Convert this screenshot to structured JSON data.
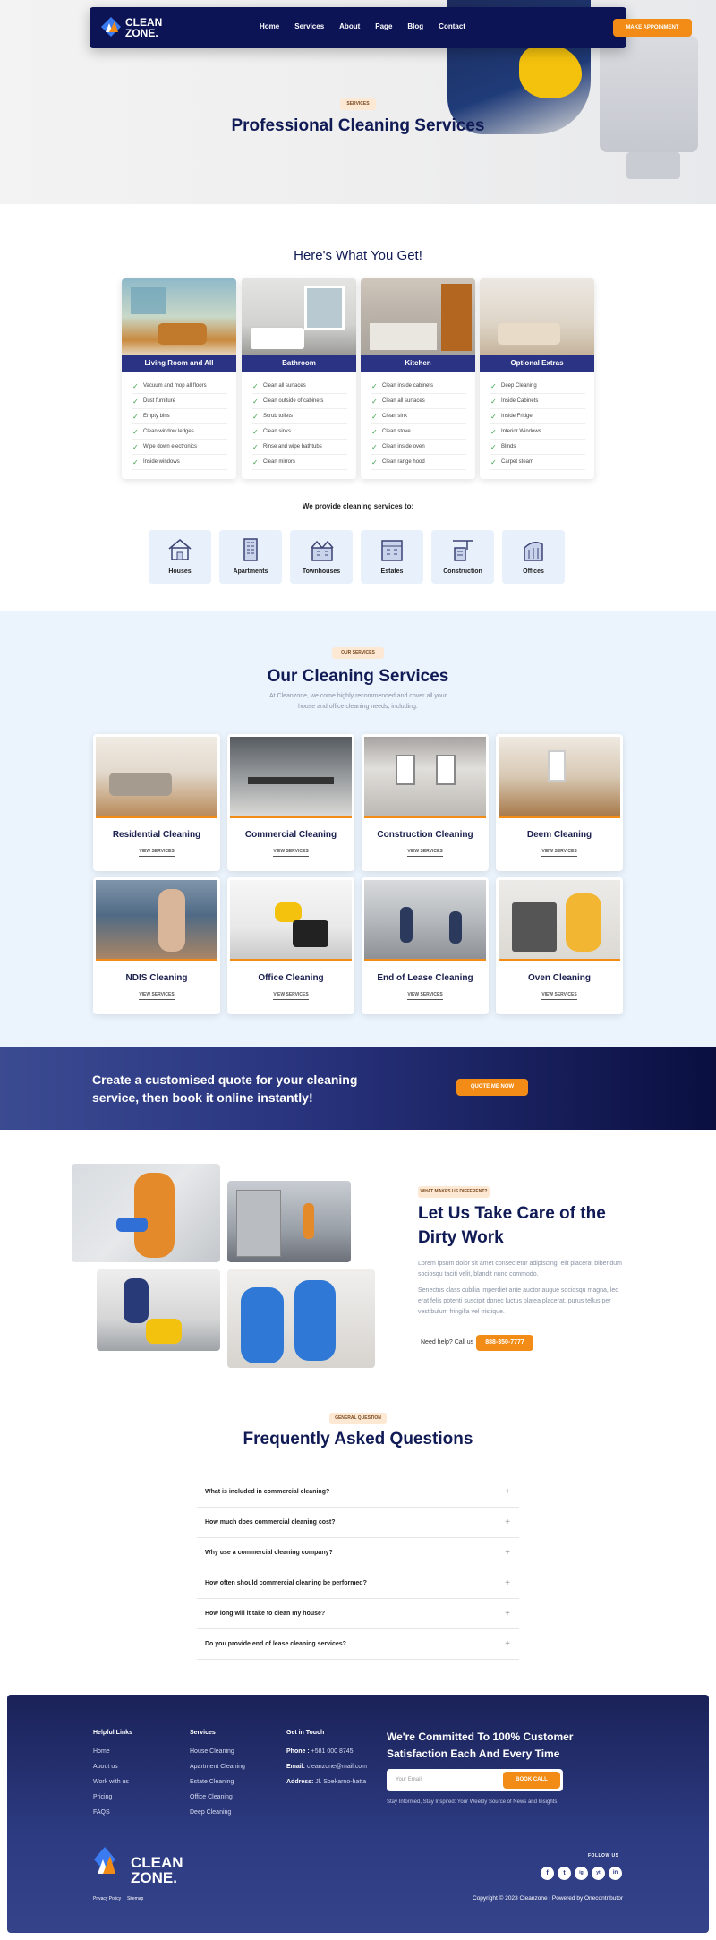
{
  "nav": {
    "logo_line1": "CLEAN",
    "logo_line2": "ZONE.",
    "items": [
      "Home",
      "Services",
      "About",
      "Page",
      "Blog",
      "Contact"
    ],
    "cta": "MAKE APPOINMENT"
  },
  "hero": {
    "badge": "SERVICES",
    "title": "Professional Cleaning Services"
  },
  "get": {
    "title": "Here's What You Get!",
    "cards": [
      {
        "title": "Living Room and All",
        "items": [
          "Vacuum and mop all floors",
          "Dust furniture",
          "Empty bins",
          "Clean window ledges",
          "Wipe down electronics",
          "Inside windows"
        ]
      },
      {
        "title": "Bathroom",
        "items": [
          "Clean all surfaces",
          "Clean outside of cabinets",
          "Scrub toilets",
          "Clean sinks",
          "Rinse and wipe bathtubs",
          "Clean mirrors"
        ]
      },
      {
        "title": "Kitchen",
        "items": [
          "Clean inside cabinets",
          "Clean all surfaces",
          "Clean sink",
          "Clean stove",
          "Clean inside oven",
          "Clean range hood"
        ]
      },
      {
        "title": "Optional Extras",
        "items": [
          "Deep Cleaning",
          "Inside Cabinets",
          "Inside Fridge",
          "Interior Windows",
          "Blinds",
          "Carpet steam"
        ]
      }
    ],
    "provide": "We provide cleaning services to:",
    "types": [
      "Houses",
      "Apartments",
      "Townhouses",
      "Estates",
      "Construction",
      "Offices"
    ]
  },
  "services": {
    "badge": "OUR SERVICES",
    "title": "Our Cleaning Services",
    "subtitle": "At Cleanzone, we come highly recommended and cover all your house and office cleaning needs, including:",
    "view": "VIEW SERVICES",
    "cards": [
      "Residential Cleaning",
      "Commercial Cleaning",
      "Construction Cleaning",
      "Deem Cleaning",
      "NDIS Cleaning",
      "Office Cleaning",
      "End of Lease Cleaning",
      "Oven Cleaning"
    ]
  },
  "cta": {
    "text": "Create a customised quote for your cleaning service, then book it online instantly!",
    "button": "QUOTE ME NOW"
  },
  "about": {
    "badge": "WHAT MAKES US DIFFERENT?",
    "title": "Let Us Take Care of the Dirty Work",
    "p1": "Lorem ipsum dolor sit amet consectetur adipiscing, elit placerat bibendum sociosqu taciti velit, blandit nunc commodo.",
    "p2": "Senectus class cubilia imperdiet ante auctor augue sociosqu magna, leo erat felis potenti suscipit donec luctus platea placerat, purus tellus per vestibulum fringilla vel tristique.",
    "help": "Need help? Call us",
    "phone": "888-350-7777"
  },
  "faq": {
    "badge": "GENERAL QUESTION",
    "title": "Frequently Asked Questions",
    "items": [
      "What is included in commercial cleaning?",
      "How much does commercial cleaning cost?",
      "Why use a commercial cleaning company?",
      "How often should commercial cleaning be performed?",
      "How long will it take to clean my house?",
      "Do you provide end of lease cleaning services?"
    ]
  },
  "footer": {
    "helpful": {
      "title": "Helpful Links",
      "links": [
        "Home",
        "About us",
        "Work with us",
        "Pricing",
        "FAQS"
      ]
    },
    "services": {
      "title": "Services",
      "links": [
        "House Cleaning",
        "Apartment Cleaning",
        "Estate Cleaning",
        "Office Cleaning",
        "Deep Cleaning"
      ]
    },
    "contact": {
      "title": "Get in Touch",
      "phone_label": "Phone :",
      "phone": "+581 000 8745",
      "email_label": "Email:",
      "email": "cleanzone@mail.com",
      "address_label": "Address:",
      "address": "Jl. Soekarno-hatta"
    },
    "commit": "We're Committed To 100% Customer Satisfaction Each And Every Time",
    "email_placeholder": "Your Email",
    "book": "BOOK CALL",
    "stay": "Stay Informed, Stay Inspired: Your Weekly Source of News and Insights.",
    "follow": "FOLLOW US",
    "socials": [
      "f",
      "t",
      "ig",
      "yt",
      "in"
    ],
    "privacy": "Privacy Policy",
    "sitemap": "Sitemap",
    "copyright": "Copyright © 2023 Cleanzone | Powered by Onecontributor"
  },
  "colors": {
    "navy": "#0d1456",
    "orange": "#f28c16",
    "light_blue": "#ebf3fd",
    "card_bar": "#2a3384"
  }
}
